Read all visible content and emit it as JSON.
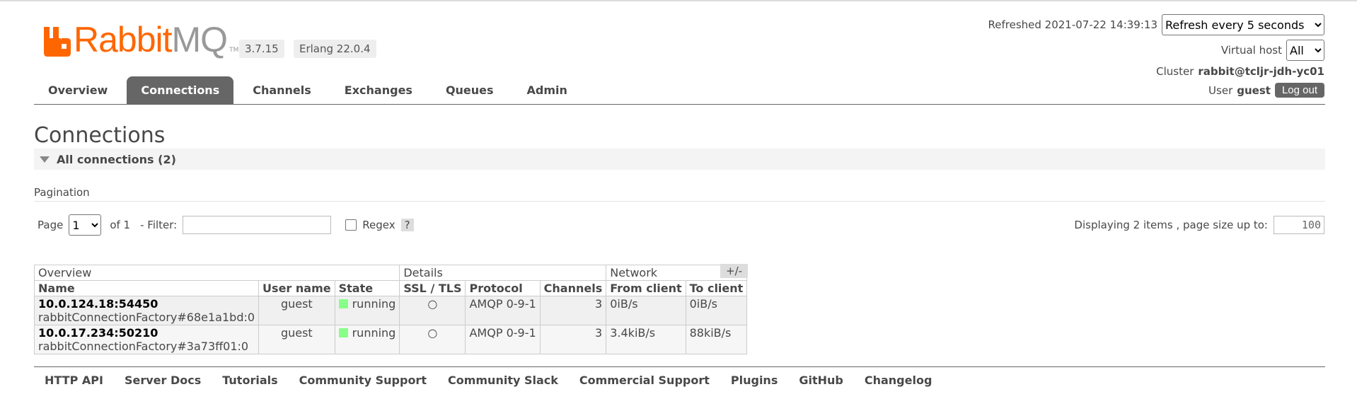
{
  "header": {
    "logo_brand": "Rabbit",
    "logo_mq": "MQ",
    "logo_tm": "TM",
    "version": "3.7.15",
    "erlang": "Erlang 22.0.4",
    "refreshed_label": "Refreshed 2021-07-22 14:39:13",
    "refresh_select": "Refresh every 5 seconds",
    "vhost_label": "Virtual host",
    "vhost_select": "All",
    "cluster_label": "Cluster",
    "cluster_name": "rabbit@tcljr-jdh-yc01",
    "user_label": "User",
    "user_name": "guest",
    "logout_label": "Log out"
  },
  "tabs": [
    "Overview",
    "Connections",
    "Channels",
    "Exchanges",
    "Queues",
    "Admin"
  ],
  "active_tab": "Connections",
  "page_title": "Connections",
  "section_title": "All connections (2)",
  "pagination": {
    "label": "Pagination",
    "page_label": "Page",
    "page_value": "1",
    "of_label": "of 1",
    "filter_label": "- Filter:",
    "filter_value": "",
    "regex_label": "Regex",
    "help_label": "?",
    "display_label": "Displaying 2 items , page size up to:",
    "page_size": "100"
  },
  "table": {
    "groups": [
      "Overview",
      "Details",
      "Network"
    ],
    "plus_minus": "+/-",
    "columns": [
      "Name",
      "User name",
      "State",
      "SSL / TLS",
      "Protocol",
      "Channels",
      "From client",
      "To client"
    ],
    "rows": [
      {
        "name": "10.0.124.18:54450",
        "client": "rabbitConnectionFactory#68e1a1bd:0",
        "user": "guest",
        "state": "running",
        "ssl": "○",
        "protocol": "AMQP 0-9-1",
        "channels": "3",
        "from_client": "0iB/s",
        "to_client": "0iB/s"
      },
      {
        "name": "10.0.17.234:50210",
        "client": "rabbitConnectionFactory#3a73ff01:0",
        "user": "guest",
        "state": "running",
        "ssl": "○",
        "protocol": "AMQP 0-9-1",
        "channels": "3",
        "from_client": "3.4kiB/s",
        "to_client": "88kiB/s"
      }
    ]
  },
  "footer": [
    "HTTP API",
    "Server Docs",
    "Tutorials",
    "Community Support",
    "Community Slack",
    "Commercial Support",
    "Plugins",
    "GitHub",
    "Changelog"
  ],
  "colors": {
    "brand": "#ff6600",
    "tab_active": "#666666",
    "state_running": "#88ff88"
  }
}
